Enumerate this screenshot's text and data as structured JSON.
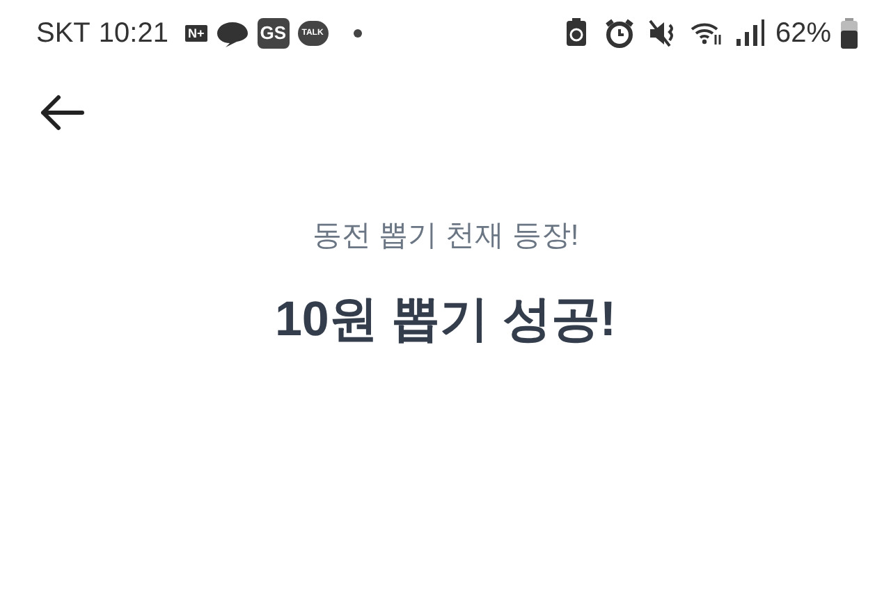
{
  "status_bar": {
    "carrier": "SKT",
    "time": "10:21",
    "notifications": [
      {
        "kind": "badge",
        "label": "N+"
      },
      {
        "kind": "bubble"
      },
      {
        "kind": "box",
        "label": "GS"
      },
      {
        "kind": "talk",
        "label": "TALK"
      },
      {
        "kind": "dot"
      }
    ],
    "indicators": [
      {
        "kind": "battery-saver"
      },
      {
        "kind": "alarm"
      },
      {
        "kind": "mute"
      },
      {
        "kind": "wifi"
      },
      {
        "kind": "signal"
      }
    ],
    "battery": "62%"
  },
  "subtitle": "동전 뽑기 천재 등장!",
  "title": "10원 뽑기 성공!"
}
